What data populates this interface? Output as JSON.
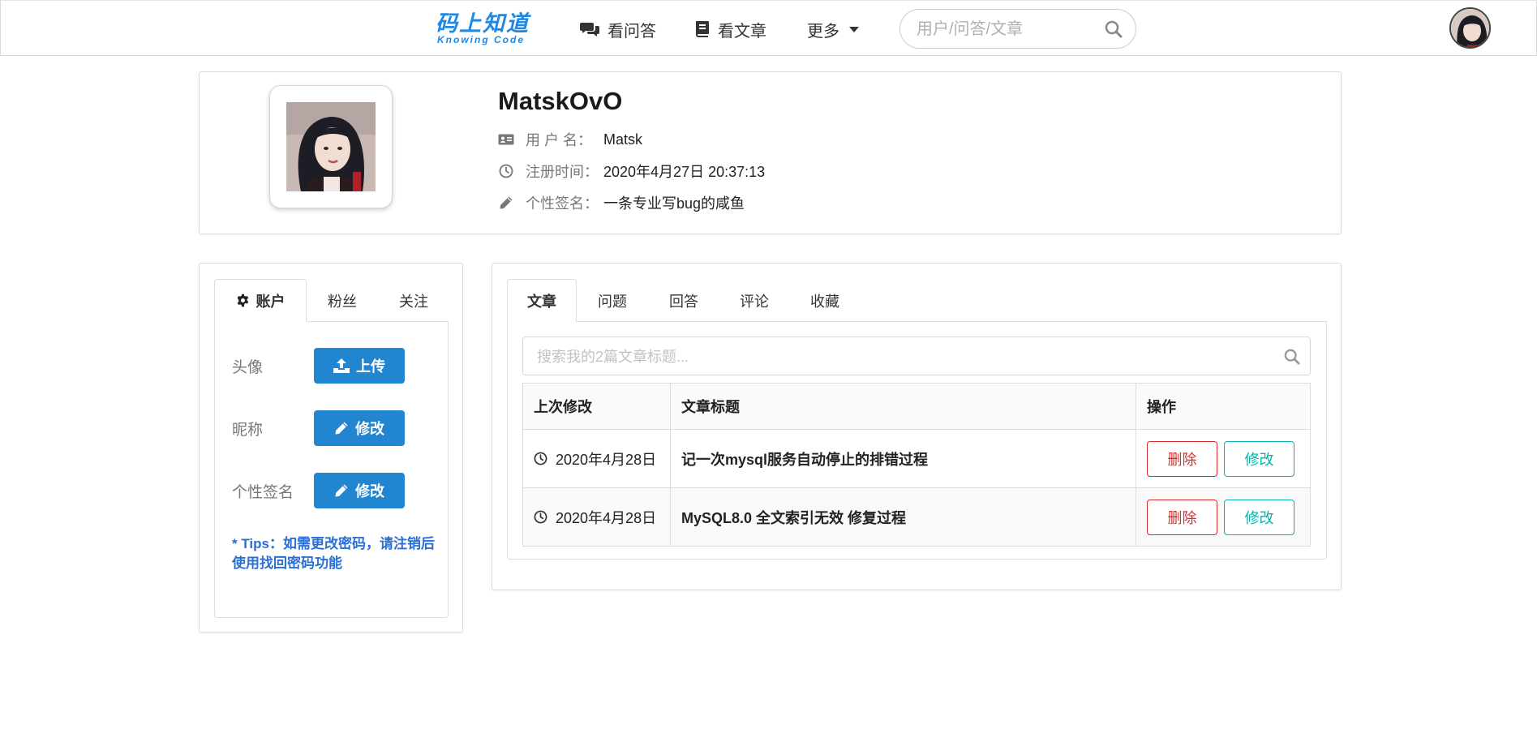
{
  "header": {
    "logo_cn": "码上知道",
    "logo_en": "Knowing Code",
    "nav_qa": "看问答",
    "nav_article": "看文章",
    "nav_more": "更多",
    "search_placeholder": "用户/问答/文章"
  },
  "profile": {
    "nickname": "MatskOvO",
    "username_label": "用 户 名：",
    "username": "Matsk",
    "register_label": "注册时间：",
    "register_time": "2020年4月27日 20:37:13",
    "signature_label": "个性签名：",
    "signature": "一条专业写bug的咸鱼"
  },
  "account_panel": {
    "tabs": [
      "账户",
      "粉丝",
      "关注"
    ],
    "avatar_label": "头像",
    "upload_button": "上传",
    "nickname_label": "昵称",
    "nickname_edit_button": "修改",
    "signature_label": "个性签名",
    "signature_edit_button": "修改",
    "tips": "* Tips：如需更改密码，请注销后使用找回密码功能"
  },
  "articles_panel": {
    "tabs": [
      "文章",
      "问题",
      "回答",
      "评论",
      "收藏"
    ],
    "search_placeholder": "搜索我的2篇文章标题...",
    "columns": [
      "上次修改",
      "文章标题",
      "操作"
    ],
    "rows": [
      {
        "date": "2020年4月28日",
        "title": "记一次mysql服务自动停止的排错过程",
        "delete": "删除",
        "edit": "修改"
      },
      {
        "date": "2020年4月28日",
        "title": "MySQL8.0 全文索引无效 修复过程",
        "delete": "删除",
        "edit": "修改"
      }
    ]
  },
  "colors": {
    "primary": "#2185d0",
    "logo": "#1e88e5",
    "danger": "#db2828",
    "teal": "#00b5ad",
    "tips": "#2b6fd6"
  }
}
